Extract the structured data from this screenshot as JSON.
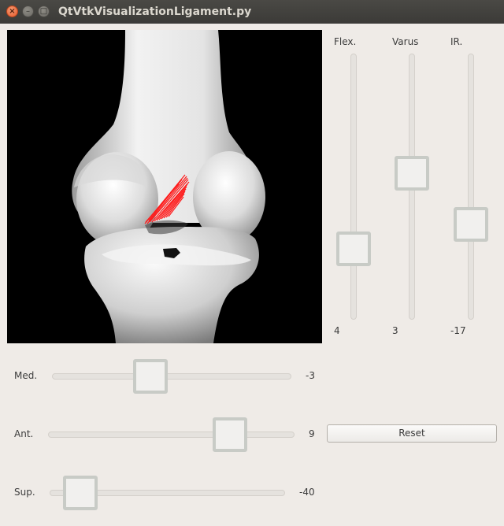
{
  "window": {
    "title": "QtVtkVisualizationLigament.py"
  },
  "window_controls": {
    "close": "×",
    "minimize": "–",
    "maximize": "□"
  },
  "sliders": {
    "flex": {
      "label": "Flex.",
      "value": "4"
    },
    "varus": {
      "label": "Varus",
      "value": "3"
    },
    "ir": {
      "label": "IR.",
      "value": "-17"
    },
    "med": {
      "label": "Med.",
      "value": "-3"
    },
    "ant": {
      "label": "Ant.",
      "value": "9"
    },
    "sup": {
      "label": "Sup.",
      "value": "-40"
    }
  },
  "reset": {
    "label": "Reset"
  },
  "viewport": {
    "background": "#000000",
    "ligament_color": "#ff1a1a",
    "bone_color": "#e8e8e8"
  }
}
